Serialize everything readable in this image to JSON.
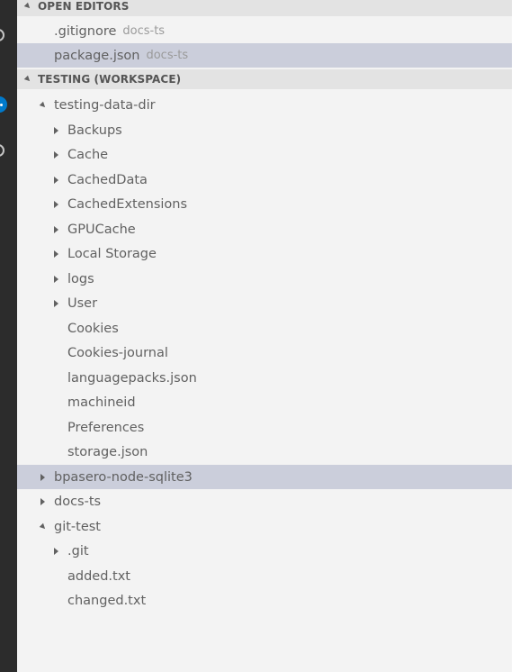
{
  "activity_bar": {
    "icons": [
      "circle-icon",
      "notification-badge-icon",
      "circle-icon"
    ]
  },
  "open_editors": {
    "title": "OPEN EDITORS",
    "items": [
      {
        "label": ".gitignore",
        "description": "docs-ts",
        "selected": false
      },
      {
        "label": "package.json",
        "description": "docs-ts",
        "selected": true
      }
    ]
  },
  "workspace": {
    "title": "TESTING (WORKSPACE)",
    "items": [
      {
        "label": "testing-data-dir",
        "depth": 0,
        "type": "folder",
        "expanded": true
      },
      {
        "label": "Backups",
        "depth": 1,
        "type": "folder",
        "expanded": false
      },
      {
        "label": "Cache",
        "depth": 1,
        "type": "folder",
        "expanded": false
      },
      {
        "label": "CachedData",
        "depth": 1,
        "type": "folder",
        "expanded": false
      },
      {
        "label": "CachedExtensions",
        "depth": 1,
        "type": "folder",
        "expanded": false
      },
      {
        "label": "GPUCache",
        "depth": 1,
        "type": "folder",
        "expanded": false
      },
      {
        "label": "Local Storage",
        "depth": 1,
        "type": "folder",
        "expanded": false
      },
      {
        "label": "logs",
        "depth": 1,
        "type": "folder",
        "expanded": false
      },
      {
        "label": "User",
        "depth": 1,
        "type": "folder",
        "expanded": false
      },
      {
        "label": "Cookies",
        "depth": 1,
        "type": "file"
      },
      {
        "label": "Cookies-journal",
        "depth": 1,
        "type": "file"
      },
      {
        "label": "languagepacks.json",
        "depth": 1,
        "type": "file"
      },
      {
        "label": "machineid",
        "depth": 1,
        "type": "file"
      },
      {
        "label": "Preferences",
        "depth": 1,
        "type": "file"
      },
      {
        "label": "storage.json",
        "depth": 1,
        "type": "file"
      },
      {
        "label": "bpasero-node-sqlite3",
        "depth": 0,
        "type": "folder",
        "expanded": false,
        "selected": true
      },
      {
        "label": "docs-ts",
        "depth": 0,
        "type": "folder",
        "expanded": false
      },
      {
        "label": "git-test",
        "depth": 0,
        "type": "folder",
        "expanded": true
      },
      {
        "label": ".git",
        "depth": 1,
        "type": "folder",
        "expanded": false
      },
      {
        "label": "added.txt",
        "depth": 1,
        "type": "file"
      },
      {
        "label": "changed.txt",
        "depth": 1,
        "type": "file"
      }
    ]
  }
}
